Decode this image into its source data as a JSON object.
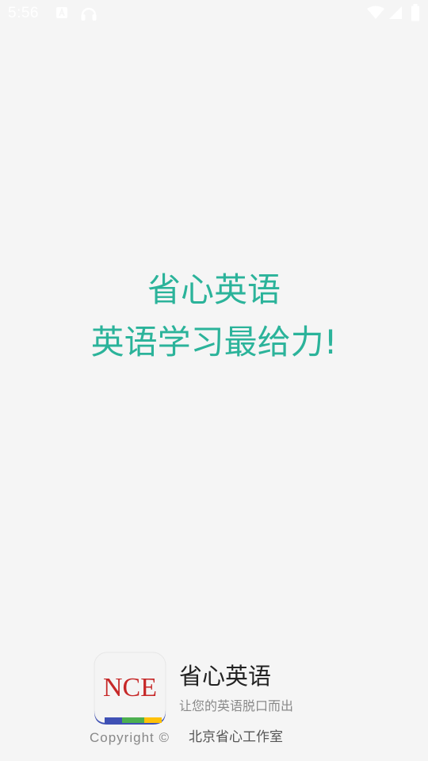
{
  "status_bar": {
    "time": "5:56",
    "icons": [
      "notification-a-icon",
      "headset-icon",
      "wifi-icon",
      "signal-icon",
      "battery-icon"
    ]
  },
  "splash": {
    "title": "省心英语",
    "slogan": "英语学习最给力!",
    "text_color": "#2bb39a"
  },
  "footer": {
    "logo_text": "NCE",
    "logo_text_color": "#c62828",
    "logo_stripe_colors": [
      "#3f51b5",
      "#4caf50",
      "#ffc107"
    ],
    "app_name": "省心英语",
    "tagline": "让您的英语脱口而出",
    "copyright": "Copyright ©",
    "studio": "北京省心工作室"
  }
}
